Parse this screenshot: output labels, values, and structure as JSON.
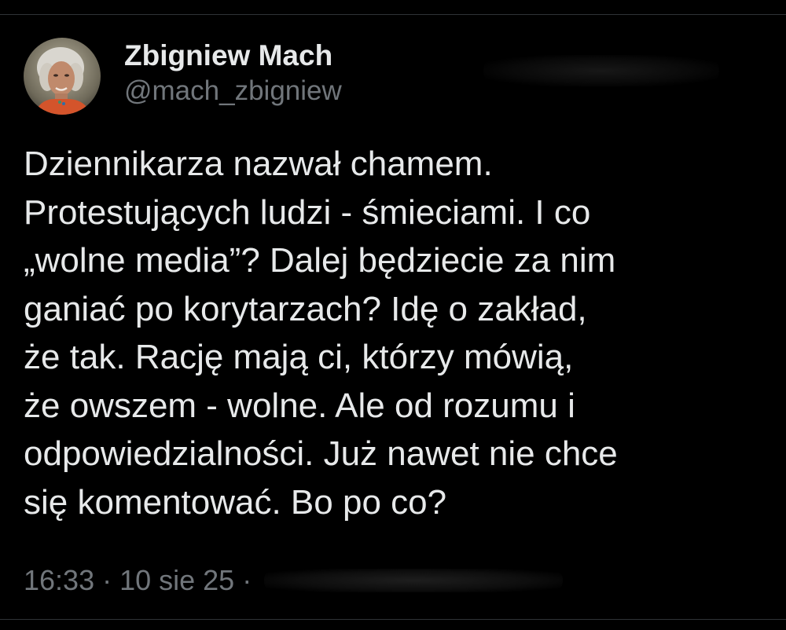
{
  "author": {
    "display_name": "Zbigniew Mach",
    "handle": "@mach_zbigniew",
    "avatar_icon": "profile-photo"
  },
  "tweet": {
    "text": "Dziennikarza nazwał chamem.\nProtestujących ludzi - śmieciami. I co\n„wolne  media”? Dalej będziecie za nim\nganiać po korytarzach? Idę o zakład,\nże tak. Rację mają ci, którzy mówią,\nże owszem - wolne. Ale od rozumu i\nodpowiedzialności. Już nawet nie chce\nsię komentować. Bo po co?",
    "time": "16:33",
    "date": "10 sie 25",
    "separator": "·"
  },
  "colors": {
    "background": "#000000",
    "primary_text": "#e7e9ea",
    "secondary_text": "#71767b",
    "divider": "#2f3336"
  }
}
